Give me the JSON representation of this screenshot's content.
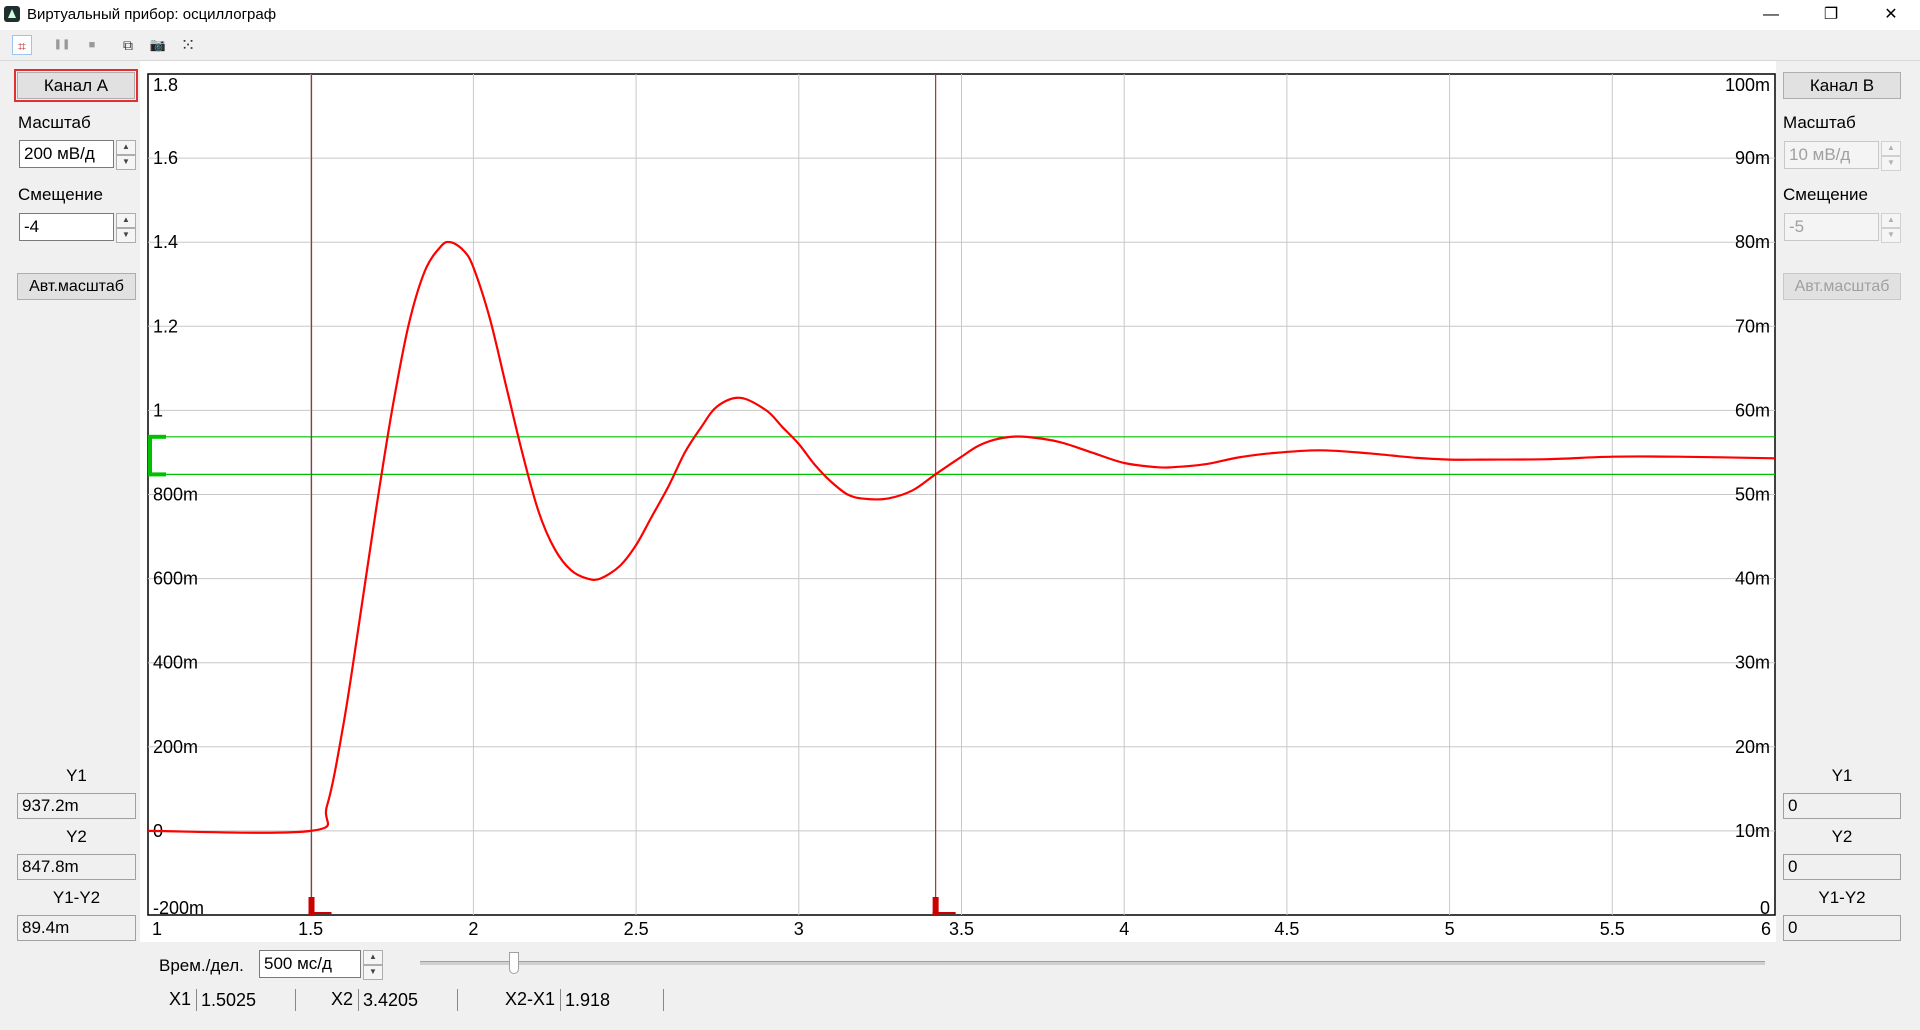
{
  "window": {
    "title": "Виртуальный прибор: осциллограф",
    "minimize_glyph": "—",
    "restore_glyph": "❐",
    "close_glyph": "✕"
  },
  "toolbar": {
    "icons": [
      "cursor-icon",
      "pause-icon",
      "stop-icon",
      "copy-icon",
      "camera-icon",
      "grid-dots-icon"
    ],
    "pause_glyph": "❚❚",
    "stop_glyph": "■",
    "copy_glyph": "⧉",
    "camera_glyph": "📷",
    "grid_glyph": "⁙",
    "cursor_glyph": "⌗"
  },
  "channel_a": {
    "button": "Канал A",
    "scale_label": "Масштаб",
    "scale_value": "200 мВ/д",
    "offset_label": "Смещение",
    "offset_value": "-4",
    "autoscale": "Авт.масштаб",
    "y1_label": "Y1",
    "y1_value": "937.2m",
    "y2_label": "Y2",
    "y2_value": "847.8m",
    "dy_label": "Y1-Y2",
    "dy_value": "89.4m"
  },
  "channel_b": {
    "button": "Канал B",
    "scale_label": "Масштаб",
    "scale_value": "10 мВ/д",
    "offset_label": "Смещение",
    "offset_value": "-5",
    "autoscale": "Авт.масштаб",
    "y1_label": "Y1",
    "y1_value": "0",
    "y2_label": "Y2",
    "y2_value": "0",
    "dy_label": "Y1-Y2",
    "dy_value": "0"
  },
  "timebase": {
    "label": "Врем./дел.",
    "value": "500 мс/д",
    "slider_fraction": 0.07
  },
  "cursors": {
    "x1_label": "X1",
    "x1_value": "1.5025",
    "x2_label": "X2",
    "x2_value": "3.4205",
    "dx_label": "X2-X1",
    "dx_value": "1.918"
  },
  "colors": {
    "trace": "#ff0000",
    "cursor_v": "#b03030",
    "cursor_h": "#00c000",
    "grid": "#c8c8c8"
  },
  "chart_data": {
    "type": "line",
    "xlim": [
      1,
      6
    ],
    "ylim_left": [
      -0.2,
      1.8
    ],
    "ylim_right": [
      0,
      0.1
    ],
    "x_ticks": [
      "1",
      "1.5",
      "2",
      "2.5",
      "3",
      "3.5",
      "4",
      "4.5",
      "5",
      "5.5",
      "6"
    ],
    "x_tick_values": [
      1,
      1.5,
      2,
      2.5,
      3,
      3.5,
      4,
      4.5,
      5,
      5.5,
      6
    ],
    "y_left_ticks": [
      "1.8",
      "1.6",
      "1.4",
      "1.2",
      "1",
      "800m",
      "600m",
      "400m",
      "200m",
      "0",
      "-200m"
    ],
    "y_left_values": [
      1.8,
      1.6,
      1.4,
      1.2,
      1.0,
      0.8,
      0.6,
      0.4,
      0.2,
      0.0,
      -0.2
    ],
    "y_right_ticks": [
      "100m",
      "90m",
      "80m",
      "70m",
      "60m",
      "50m",
      "40m",
      "30m",
      "20m",
      "10m",
      "0"
    ],
    "grid": true,
    "cursor_x1": 1.5025,
    "cursor_x2": 3.4205,
    "cursor_y1": 0.9372,
    "cursor_y2": 0.8478,
    "series": [
      {
        "x": [
          1.0,
          1.5,
          1.55,
          1.6,
          1.65,
          1.7,
          1.75,
          1.8,
          1.85,
          1.9,
          1.93,
          1.97,
          2.0,
          2.05,
          2.1,
          2.15,
          2.2,
          2.25,
          2.3,
          2.35,
          2.39,
          2.45,
          2.5,
          2.55,
          2.6,
          2.65,
          2.7,
          2.75,
          2.82,
          2.9,
          2.95,
          3.0,
          3.05,
          3.1,
          3.15,
          3.2,
          3.27,
          3.35,
          3.42,
          3.5,
          3.55,
          3.6,
          3.65,
          3.7,
          3.8,
          3.9,
          4.0,
          4.1,
          4.15,
          4.25,
          4.35,
          4.45,
          4.6,
          4.75,
          4.9,
          5.0,
          5.1,
          5.3,
          5.5,
          5.7,
          6.0
        ],
        "y": [
          0.0,
          0.0,
          0.06,
          0.25,
          0.5,
          0.76,
          1.0,
          1.2,
          1.33,
          1.39,
          1.4,
          1.38,
          1.34,
          1.22,
          1.06,
          0.9,
          0.76,
          0.67,
          0.62,
          0.6,
          0.6,
          0.63,
          0.68,
          0.75,
          0.82,
          0.9,
          0.96,
          1.01,
          1.03,
          1.0,
          0.96,
          0.92,
          0.87,
          0.83,
          0.8,
          0.79,
          0.79,
          0.81,
          0.848,
          0.89,
          0.915,
          0.93,
          0.937,
          0.937,
          0.925,
          0.9,
          0.875,
          0.865,
          0.865,
          0.872,
          0.888,
          0.898,
          0.905,
          0.898,
          0.887,
          0.883,
          0.883,
          0.884,
          0.89,
          0.89,
          0.886
        ]
      }
    ]
  }
}
